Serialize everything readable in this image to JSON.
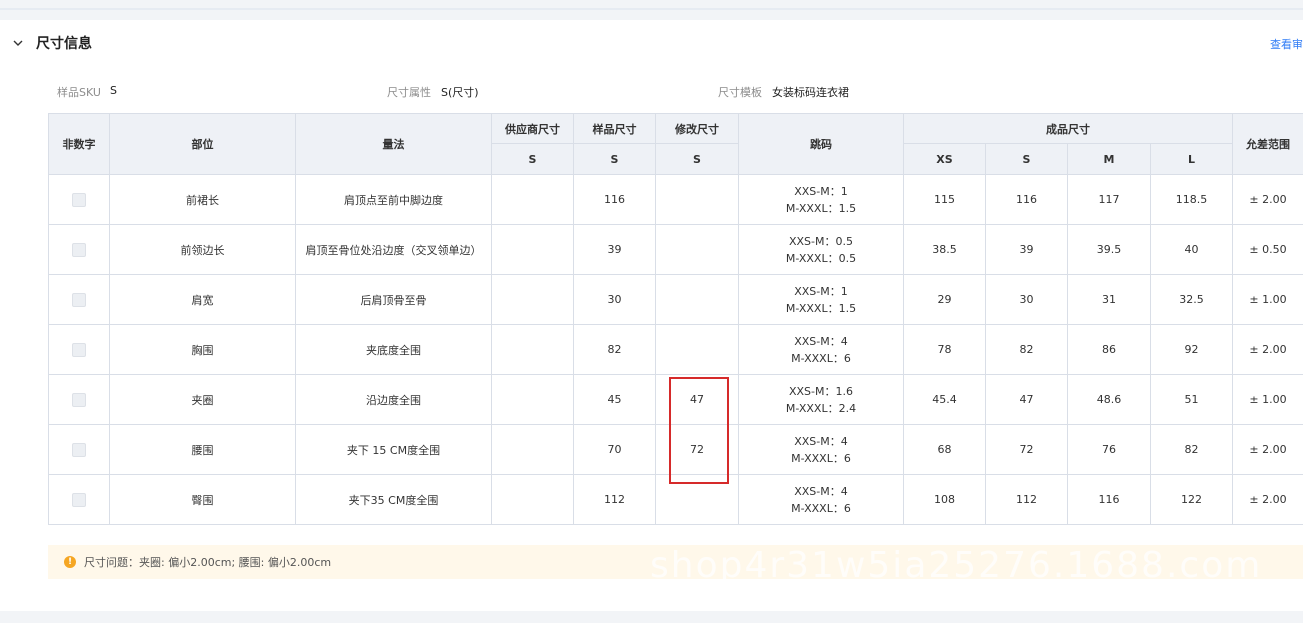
{
  "section": {
    "title": "尺寸信息",
    "audit_link": "查看审"
  },
  "info": {
    "sku_label": "样品SKU",
    "sku_value": "S",
    "attr_label": "尺寸属性",
    "attr_value": "S(尺寸)",
    "template_label": "尺寸模板",
    "template_value": "女装标码连衣裙"
  },
  "table": {
    "headers": {
      "non_numeric": "非数字",
      "part": "部位",
      "method": "量法",
      "supplier": "供应商尺寸",
      "sample": "样品尺寸",
      "modified": "修改尺寸",
      "grading": "跳码",
      "finished": "成品尺寸",
      "tolerance": "允差范围",
      "supplier_sub": "S",
      "sample_sub": "S",
      "modified_sub": "S",
      "size_xs": "XS",
      "size_s": "S",
      "size_m": "M",
      "size_l": "L"
    },
    "rows": [
      {
        "part": "前裙长",
        "method": "肩顶点至前中脚边度",
        "supplier": "",
        "sample": "116",
        "modified": "",
        "jump1": "XXS-M：1",
        "jump2": "M-XXXL：1.5",
        "xs": "115",
        "s": "116",
        "m": "117",
        "l": "118.5",
        "tol": "± 2.00"
      },
      {
        "part": "前领边长",
        "method": "肩顶至骨位处沿边度（交叉领单边）",
        "supplier": "",
        "sample": "39",
        "modified": "",
        "jump1": "XXS-M：0.5",
        "jump2": "M-XXXL：0.5",
        "xs": "38.5",
        "s": "39",
        "m": "39.5",
        "l": "40",
        "tol": "± 0.50"
      },
      {
        "part": "肩宽",
        "method": "后肩顶骨至骨",
        "supplier": "",
        "sample": "30",
        "modified": "",
        "jump1": "XXS-M：1",
        "jump2": "M-XXXL：1.5",
        "xs": "29",
        "s": "30",
        "m": "31",
        "l": "32.5",
        "tol": "± 1.00"
      },
      {
        "part": "胸围",
        "method": "夹底度全围",
        "supplier": "",
        "sample": "82",
        "modified": "",
        "jump1": "XXS-M：4",
        "jump2": "M-XXXL：6",
        "xs": "78",
        "s": "82",
        "m": "86",
        "l": "92",
        "tol": "± 2.00"
      },
      {
        "part": "夹圈",
        "method": "沿边度全围",
        "supplier": "",
        "sample": "45",
        "modified": "47",
        "jump1": "XXS-M：1.6",
        "jump2": "M-XXXL：2.4",
        "xs": "45.4",
        "s": "47",
        "m": "48.6",
        "l": "51",
        "tol": "± 1.00"
      },
      {
        "part": "腰围",
        "method": "夹下 15 CM度全围",
        "supplier": "",
        "sample": "70",
        "modified": "72",
        "jump1": "XXS-M：4",
        "jump2": "M-XXXL：6",
        "xs": "68",
        "s": "72",
        "m": "76",
        "l": "82",
        "tol": "± 2.00"
      },
      {
        "part": "臀围",
        "method": "夹下35 CM度全围",
        "supplier": "",
        "sample": "112",
        "modified": "",
        "jump1": "XXS-M：4",
        "jump2": "M-XXXL：6",
        "xs": "108",
        "s": "112",
        "m": "116",
        "l": "122",
        "tol": "± 2.00"
      }
    ]
  },
  "alert": {
    "text": "尺寸问题：夹圈: 偏小2.00cm; 腰围: 偏小2.00cm"
  },
  "watermark": "shop4r31w5ia25276.1688.com"
}
